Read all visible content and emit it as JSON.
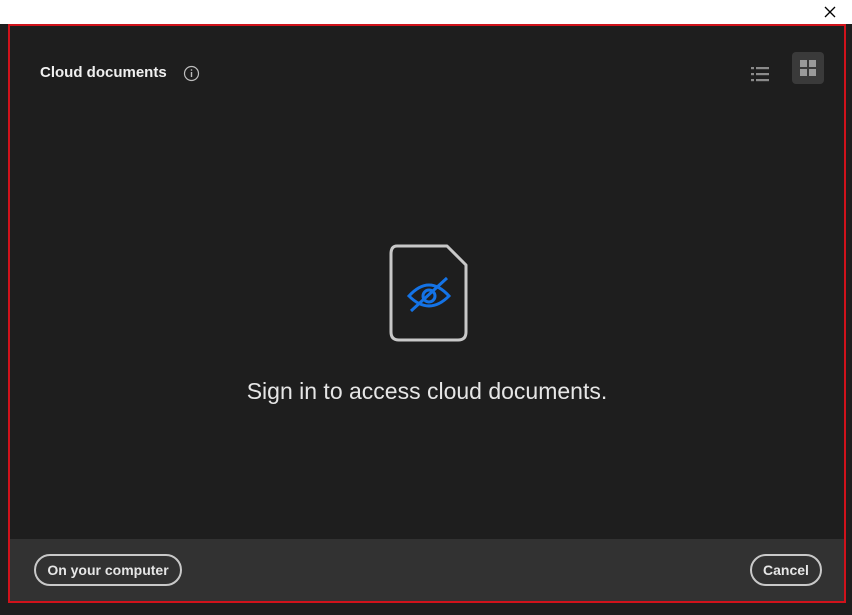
{
  "titlebar": {
    "close_icon": "close-icon"
  },
  "header": {
    "title": "Cloud documents",
    "info_icon": "info-icon",
    "view_list_icon": "list-view-icon",
    "view_grid_icon": "grid-view-icon"
  },
  "empty_state": {
    "icon": "hidden-document-icon",
    "message": "Sign in to access cloud documents."
  },
  "footer": {
    "on_computer_label": "On your computer",
    "cancel_label": "Cancel"
  },
  "colors": {
    "dialog_border": "#d0121b",
    "accent_blue": "#1473e6",
    "background": "#1e1e1e",
    "footer_background": "#323232"
  }
}
